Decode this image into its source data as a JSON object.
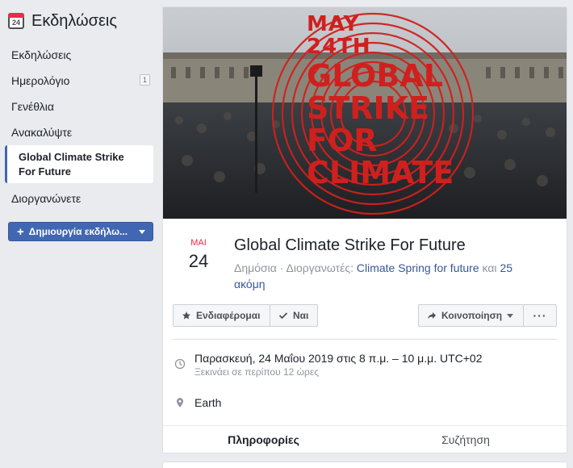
{
  "sidebar": {
    "title": "Εκδηλώσεις",
    "calendar_day": "24",
    "items": [
      {
        "label": "Εκδηλώσεις"
      },
      {
        "label": "Ημερολόγιο",
        "badge": "1"
      },
      {
        "label": "Γενέθλια"
      },
      {
        "label": "Ανακαλύψτε"
      },
      {
        "label": "Global Climate Strike For Future",
        "line1": "Global Climate Strike",
        "line2": "For Future"
      },
      {
        "label": "Διοργανώνετε"
      }
    ],
    "create_button": "Δημιουργία εκδήλω..."
  },
  "cover": {
    "line1": "MAY",
    "line2": "24TH",
    "line3": "GLOBAL",
    "line4": "STRIKE",
    "line5": "FOR",
    "line6": "CLIMATE",
    "accent_color": "#d0201e"
  },
  "event": {
    "month": "ΜΑΙ",
    "day": "24",
    "title": "Global Climate Strike For Future",
    "privacy": "Δημόσια",
    "separator": "·",
    "organizers_label": "Διοργανωτές:",
    "organizer": "Climate Spring for future",
    "and_more_prefix": "και",
    "and_more": "25 ακόμη"
  },
  "actions": {
    "interested": "Ενδιαφέρομαι",
    "going": "Ναι",
    "share": "Κοινοποίηση",
    "more": "···"
  },
  "details": {
    "datetime": "Παρασκευή, 24 Μαΐου 2019 στις 8 π.μ. – 10 μ.μ. UTC+02",
    "starts_in": "Ξεκινάει σε περίπου 12 ώρες",
    "location": "Earth"
  },
  "tabs": [
    {
      "label": "Πληροφορίες"
    },
    {
      "label": "Συζήτηση"
    }
  ],
  "colors": {
    "brand": "#4267b2",
    "date_red": "#f02849",
    "link": "#365899"
  }
}
